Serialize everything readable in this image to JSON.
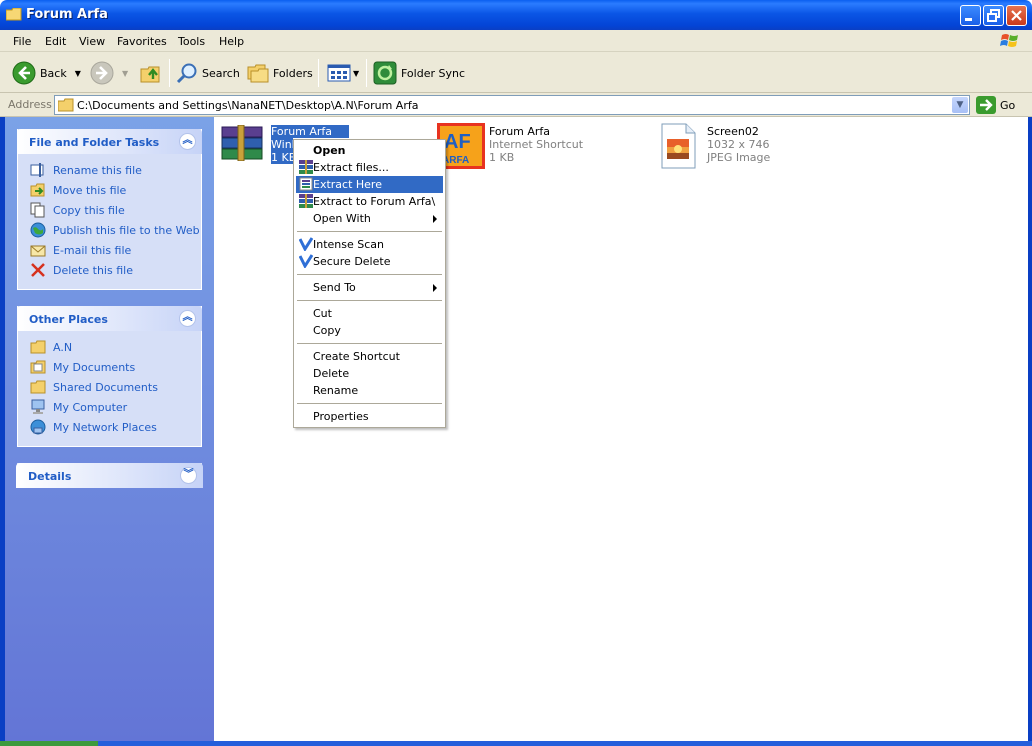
{
  "window": {
    "title": "Forum Arfa"
  },
  "menubar": {
    "items": [
      "File",
      "Edit",
      "View",
      "Favorites",
      "Tools",
      "Help"
    ]
  },
  "toolbar": {
    "back": "Back",
    "search": "Search",
    "folders": "Folders",
    "folder_sync": "Folder Sync"
  },
  "address": {
    "label": "Address",
    "path": "C:\\Documents and Settings\\NanaNET\\Desktop\\A.N\\Forum Arfa",
    "go": "Go"
  },
  "file_tasks": {
    "title": "File and Folder Tasks",
    "items": [
      "Rename this file",
      "Move this file",
      "Copy this file",
      "Publish this file to the Web",
      "E-mail this file",
      "Delete this file"
    ]
  },
  "other_places": {
    "title": "Other Places",
    "items": [
      "A.N",
      "My Documents",
      "Shared Documents",
      "My Computer",
      "My Network Places"
    ]
  },
  "details": {
    "title": "Details"
  },
  "files": [
    {
      "name": "Forum Arfa",
      "type": "WinR",
      "size": "1 KB"
    },
    {
      "name": "Forum Arfa",
      "type": "Internet Shortcut",
      "size": "1 KB"
    },
    {
      "name": "Screen02",
      "dims": "1032 x 746",
      "type": "JPEG Image"
    }
  ],
  "context_menu": {
    "open": "Open",
    "extract_files": "Extract files...",
    "extract_here": "Extract Here",
    "extract_to": "Extract to Forum Arfa\\",
    "open_with": "Open With",
    "intense_scan": "Intense Scan",
    "secure_delete": "Secure Delete",
    "send_to": "Send To",
    "cut": "Cut",
    "copy": "Copy",
    "create_shortcut": "Create Shortcut",
    "delete": "Delete",
    "rename": "Rename",
    "properties": "Properties"
  },
  "colors": {
    "title_bar": "#0344d6",
    "task_link": "#215dc6",
    "menu_highlight": "#316ac5"
  }
}
